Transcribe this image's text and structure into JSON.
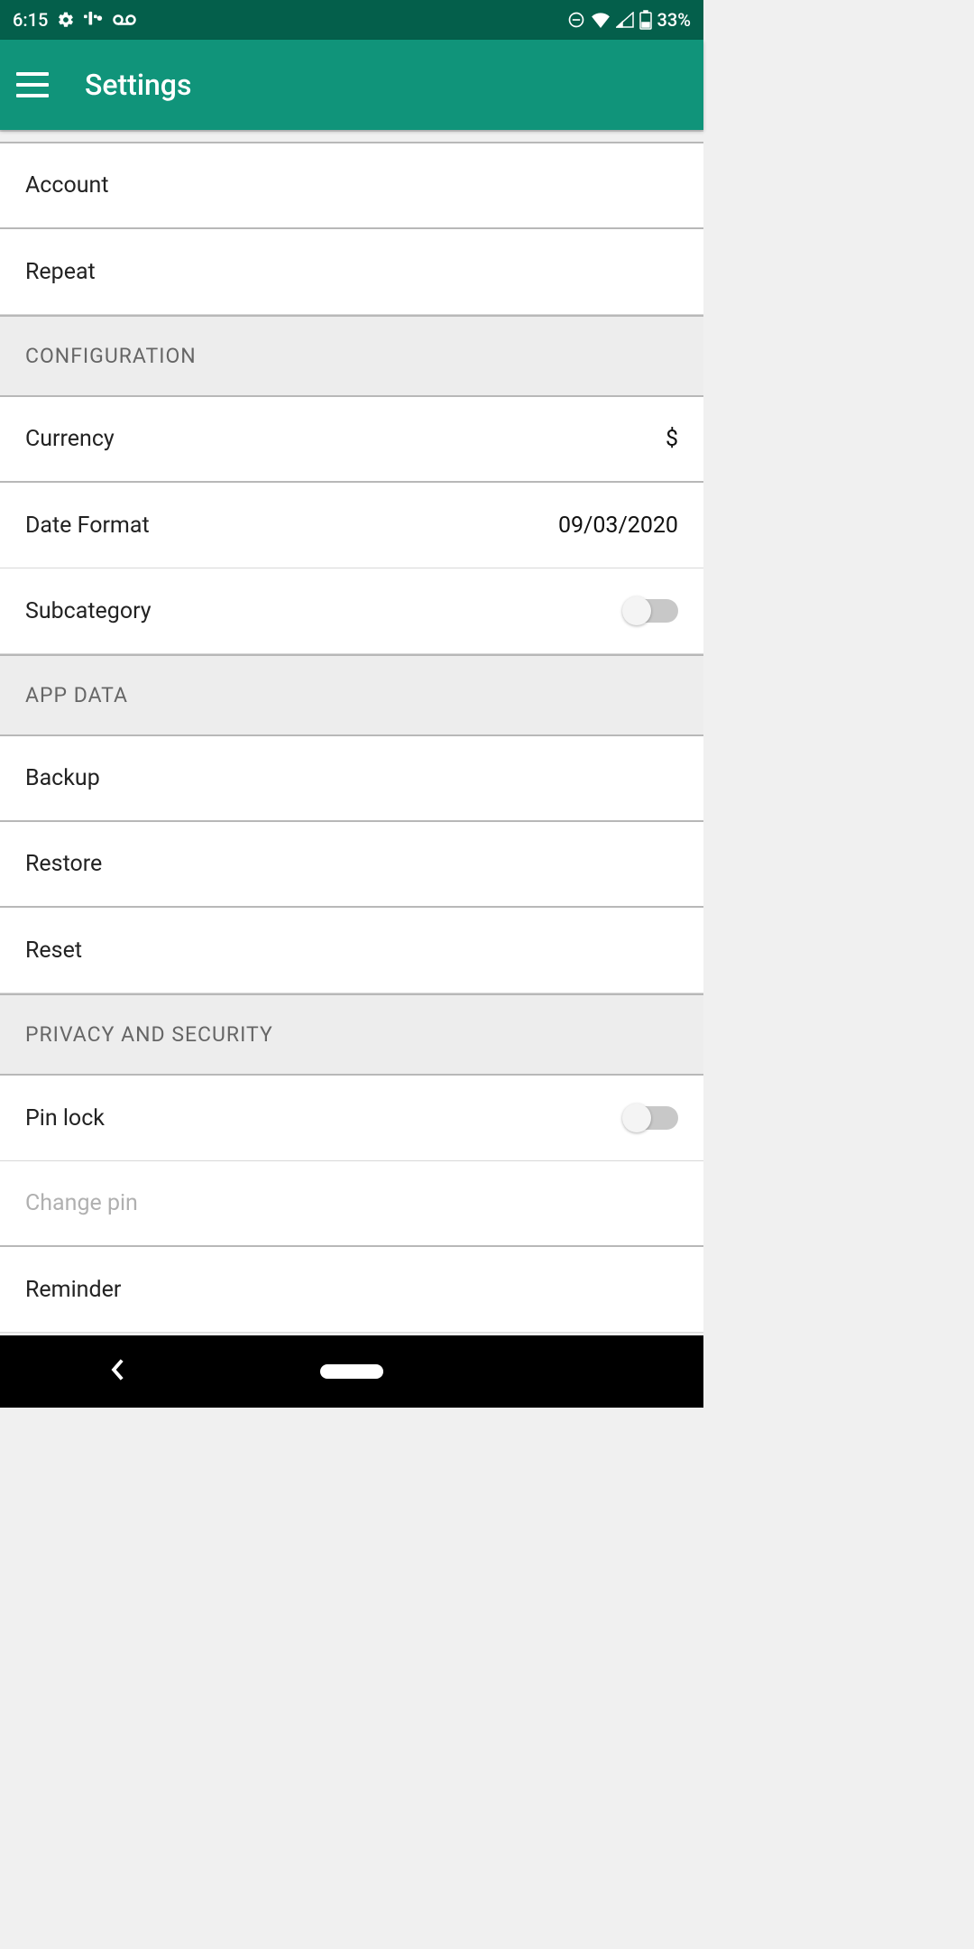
{
  "statusBar": {
    "time": "6:15",
    "battery": "33%"
  },
  "appBar": {
    "title": "Settings"
  },
  "items": {
    "account": "Account",
    "repeat": "Repeat",
    "currency": {
      "label": "Currency",
      "value": "$"
    },
    "dateFormat": {
      "label": "Date Format",
      "value": "09/03/2020"
    },
    "subcategory": {
      "label": "Subcategory",
      "on": false
    },
    "backup": "Backup",
    "restore": "Restore",
    "reset": "Reset",
    "pinLock": {
      "label": "Pin lock",
      "on": false
    },
    "changePin": "Change pin",
    "reminder": "Reminder"
  },
  "sections": {
    "configuration": "CONFIGURATION",
    "appData": "APP DATA",
    "privacy": "PRIVACY AND SECURITY"
  }
}
